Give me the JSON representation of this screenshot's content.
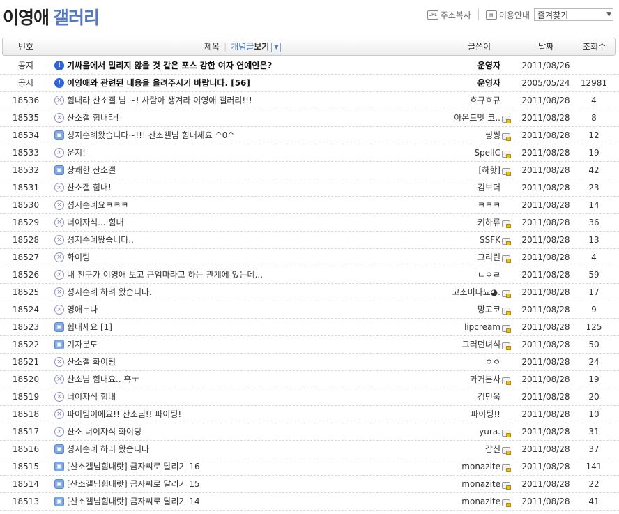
{
  "header": {
    "title_black": "이영애",
    "title_blue": "갤러리",
    "links": {
      "copy_address": "주소복사",
      "usage_guide": "이용안내",
      "favorites_select": "즐겨찾기"
    }
  },
  "columns": {
    "no": "번호",
    "title": "제목",
    "concept": "개념글",
    "view": "보기",
    "writer": "글쓴이",
    "date": "날짜",
    "views": "조회수"
  },
  "rows": [
    {
      "no": "공지",
      "icon": "notice",
      "title": "기싸움에서 밀리지 않을 것 같은 포스 강한 여자 연예인은?",
      "writer": "운영자",
      "lock": false,
      "date": "2011/08/26",
      "views": "",
      "notice": true
    },
    {
      "no": "공지",
      "icon": "notice",
      "title": "이영애와 관련된 내용을 올려주시기 바랍니다. [56]",
      "writer": "운영자",
      "lock": false,
      "date": "2005/05/24",
      "views": "12981",
      "notice": true
    },
    {
      "no": "18536",
      "icon": "x",
      "title": "힘내라 산소갤 님 ~! 사람아 생겨라 이영애 갤러리!!!",
      "writer": "흐규흐규",
      "lock": false,
      "date": "2011/08/28",
      "views": "4",
      "notice": false
    },
    {
      "no": "18535",
      "icon": "x",
      "title": "산소갤 힘내라!",
      "writer": "아몬드맛 코..",
      "lock": true,
      "date": "2011/08/28",
      "views": "8",
      "notice": false
    },
    {
      "no": "18534",
      "icon": "img",
      "title": "성지순례왔습니다~!!! 산소갤님 힘내세요 ^0^",
      "writer": "씽씽",
      "lock": true,
      "date": "2011/08/28",
      "views": "12",
      "notice": false
    },
    {
      "no": "18533",
      "icon": "x",
      "title": "운지!",
      "writer": "SpellC",
      "lock": true,
      "date": "2011/08/28",
      "views": "19",
      "notice": false
    },
    {
      "no": "18532",
      "icon": "img",
      "title": "상쾌한 산소갤",
      "writer": "[하핫]",
      "lock": true,
      "date": "2011/08/28",
      "views": "42",
      "notice": false
    },
    {
      "no": "18531",
      "icon": "x",
      "title": "산소갤 힘내!",
      "writer": "김보더",
      "lock": false,
      "date": "2011/08/28",
      "views": "23",
      "notice": false
    },
    {
      "no": "18530",
      "icon": "x",
      "title": "성지순례요ㅋㅋㅋ",
      "writer": "ㅋㅋㅋ",
      "lock": false,
      "date": "2011/08/28",
      "views": "14",
      "notice": false
    },
    {
      "no": "18529",
      "icon": "x",
      "title": "너이자식... 힘내",
      "writer": "키하류",
      "lock": true,
      "date": "2011/08/28",
      "views": "36",
      "notice": false
    },
    {
      "no": "18528",
      "icon": "x",
      "title": "성지순례왔습니다..",
      "writer": "SSFK",
      "lock": true,
      "date": "2011/08/28",
      "views": "13",
      "notice": false
    },
    {
      "no": "18527",
      "icon": "x",
      "title": "화이팅",
      "writer": "그리린",
      "lock": true,
      "date": "2011/08/28",
      "views": "4",
      "notice": false
    },
    {
      "no": "18526",
      "icon": "x",
      "title": "내 친구가 이영애 보고 큰엄마라고 하는 관계에 있는데...",
      "writer": "ㄴㅇㄹ",
      "lock": false,
      "date": "2011/08/28",
      "views": "59",
      "notice": false
    },
    {
      "no": "18525",
      "icon": "x",
      "title": "성지순례 하려 왔습니다.",
      "writer": "고소미다뇨◕.",
      "lock": true,
      "date": "2011/08/28",
      "views": "17",
      "notice": false
    },
    {
      "no": "18524",
      "icon": "x",
      "title": "영애누나",
      "writer": "망고코",
      "lock": true,
      "date": "2011/08/28",
      "views": "9",
      "notice": false
    },
    {
      "no": "18523",
      "icon": "img",
      "title": "힘내세요 [1]",
      "writer": "lipcream",
      "lock": true,
      "date": "2011/08/28",
      "views": "125",
      "notice": false
    },
    {
      "no": "18522",
      "icon": "img",
      "title": "기자분도",
      "writer": "그러던녀석",
      "lock": true,
      "date": "2011/08/28",
      "views": "50",
      "notice": false
    },
    {
      "no": "18521",
      "icon": "x",
      "title": "산소갤 화이팅",
      "writer": "ㅇㅇ",
      "lock": false,
      "date": "2011/08/28",
      "views": "24",
      "notice": false
    },
    {
      "no": "18520",
      "icon": "x",
      "title": "산소님 힘내요.. 흑ㅜ",
      "writer": "과거분사",
      "lock": true,
      "date": "2011/08/28",
      "views": "19",
      "notice": false
    },
    {
      "no": "18519",
      "icon": "x",
      "title": "너이자식 힘내",
      "writer": "김민욱",
      "lock": false,
      "date": "2011/08/28",
      "views": "20",
      "notice": false
    },
    {
      "no": "18518",
      "icon": "x",
      "title": "파이팅이에요!! 산소님!! 파이팅!",
      "writer": "파이팅!!",
      "lock": false,
      "date": "2011/08/28",
      "views": "10",
      "notice": false
    },
    {
      "no": "18517",
      "icon": "x",
      "title": "산소 너이자식 화이팅",
      "writer": "yura.",
      "lock": true,
      "date": "2011/08/28",
      "views": "31",
      "notice": false
    },
    {
      "no": "18516",
      "icon": "img",
      "title": "성지순례 하러 왔습니다",
      "writer": "갑신",
      "lock": true,
      "date": "2011/08/28",
      "views": "37",
      "notice": false
    },
    {
      "no": "18515",
      "icon": "img",
      "title": "[산소갤님힘내랏] 금자씨로 달리기 16",
      "writer": "monazite",
      "lock": true,
      "date": "2011/08/28",
      "views": "141",
      "notice": false
    },
    {
      "no": "18514",
      "icon": "img",
      "title": "[산소갤님힘내랏] 금자씨로 달리기 15",
      "writer": "monazite",
      "lock": true,
      "date": "2011/08/28",
      "views": "22",
      "notice": false
    },
    {
      "no": "18513",
      "icon": "img",
      "title": "[산소갤님힘내랏] 금자씨로 달리기 14",
      "writer": "monazite",
      "lock": true,
      "date": "2011/08/28",
      "views": "41",
      "notice": false
    }
  ]
}
